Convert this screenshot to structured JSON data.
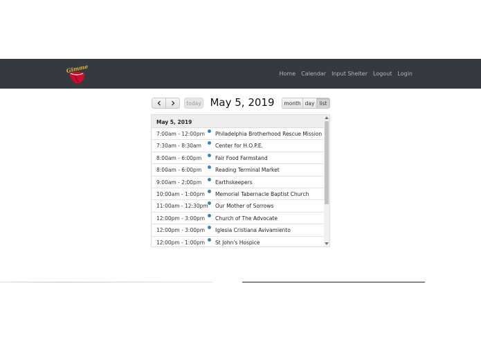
{
  "nav": {
    "logo_text": "Gimme Shelter",
    "links": [
      "Home",
      "Calendar",
      "Input Shelter",
      "Logout",
      "Login"
    ]
  },
  "toolbar": {
    "prev_icon": "chevron-left-icon",
    "next_icon": "chevron-right-icon",
    "today_label": "today",
    "title": "May 5, 2019",
    "views": [
      "month",
      "day",
      "list"
    ],
    "active_view": "list"
  },
  "list": {
    "day_heading": "May 5, 2019",
    "events": [
      {
        "time": "7:00am - 12:00pm",
        "title": "Philadelphia Brotherhood Rescue Mission"
      },
      {
        "time": "7:30am - 8:30am",
        "title": "Center for H.O.P.E."
      },
      {
        "time": "8:00am - 6:00pm",
        "title": "Fair Food Farmstand"
      },
      {
        "time": "8:00am - 6:00pm",
        "title": "Reading Terminal Market"
      },
      {
        "time": "9:00am - 2:00pm",
        "title": "Earthskeepers"
      },
      {
        "time": "10:00am - 1:00pm",
        "title": "Memorial Tabernacle Baptist Church"
      },
      {
        "time": "11:00am - 12:30pm",
        "title": "Our Mother of Sorrows"
      },
      {
        "time": "12:00pm - 3:00pm",
        "title": "Church of The Advocate"
      },
      {
        "time": "12:00pm - 3:00pm",
        "title": "Iglesia Cristiana Avivamiento"
      },
      {
        "time": "12:00pm - 1:00pm",
        "title": "St John's Hospice"
      }
    ]
  },
  "colors": {
    "navbar": "#343a40",
    "event_dot": "#3a87ad",
    "logo_red": "#c8102e",
    "logo_gold": "#e8b428"
  }
}
